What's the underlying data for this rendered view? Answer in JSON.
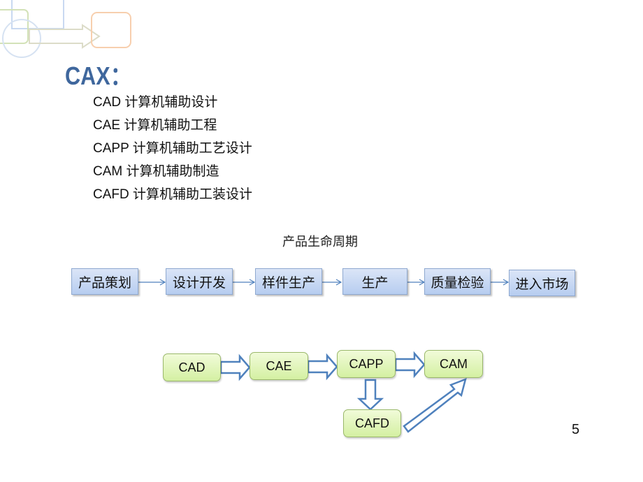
{
  "slide": {
    "title": "CAX：",
    "page_number": "5"
  },
  "definitions": [
    {
      "abbr": "CAD",
      "meaning": "计算机辅助设计"
    },
    {
      "abbr": "CAE",
      "meaning": "计算机辅助工程"
    },
    {
      "abbr": "CAPP",
      "meaning": "计算机辅助工艺设计"
    },
    {
      "abbr": "CAM",
      "meaning": "计算机辅助制造"
    },
    {
      "abbr": "CAFD",
      "meaning": "计算机辅助工装设计"
    }
  ],
  "lifecycle": {
    "title": "产品生命周期",
    "stages": [
      "产品策划",
      "设计开发",
      "样件生产",
      "生产",
      "质量检验",
      "进入市场"
    ]
  },
  "cax_flow": {
    "nodes": [
      "CAD",
      "CAE",
      "CAPP",
      "CAM",
      "CAFD"
    ],
    "edges": [
      {
        "from": "CAD",
        "to": "CAE"
      },
      {
        "from": "CAE",
        "to": "CAPP"
      },
      {
        "from": "CAPP",
        "to": "CAM"
      },
      {
        "from": "CAPP",
        "to": "CAFD"
      },
      {
        "from": "CAFD",
        "to": "CAM"
      }
    ]
  },
  "colors": {
    "title": "#3f679d",
    "stage_fill": "#c6d7f3",
    "node_fill": "#dff5b5",
    "arrow_stroke": "#4f81bd"
  }
}
